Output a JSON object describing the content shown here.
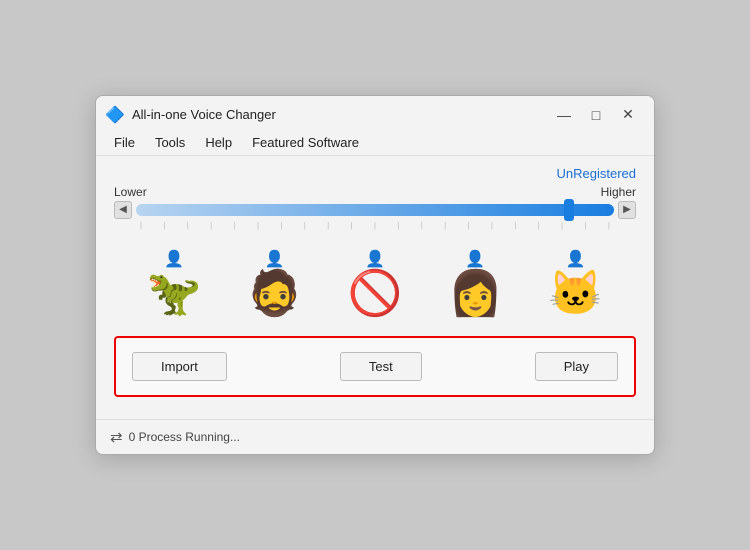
{
  "window": {
    "title": "All-in-one Voice Changer",
    "icon": "🔷",
    "controls": {
      "minimize": "—",
      "maximize": "□",
      "close": "✕"
    }
  },
  "menu": {
    "items": [
      "File",
      "Tools",
      "Help",
      "Featured Software"
    ]
  },
  "header": {
    "unregistered_label": "UnRegistered"
  },
  "slider": {
    "lower_label": "Lower",
    "higher_label": "Higher",
    "left_arrow": "◀",
    "right_arrow": "▶"
  },
  "avatars": [
    {
      "pin": "👤",
      "emoji": "🦖",
      "name": "dragon"
    },
    {
      "pin": "👤",
      "emoji": "🧔",
      "name": "man"
    },
    {
      "pin": "👤",
      "emoji": "🚫",
      "name": "none"
    },
    {
      "pin": "👤",
      "emoji": "👩",
      "name": "woman"
    },
    {
      "pin": "👤",
      "emoji": "🐱",
      "name": "cat"
    }
  ],
  "actions": {
    "import_label": "Import",
    "test_label": "Test",
    "play_label": "Play"
  },
  "status": {
    "icon": "⇄",
    "text": "0 Process Running..."
  }
}
